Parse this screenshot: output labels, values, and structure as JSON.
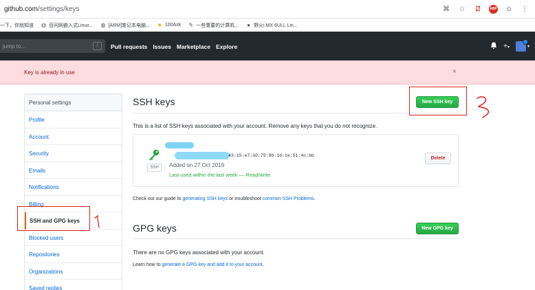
{
  "browser": {
    "url_host": "github.com",
    "url_path": "/settings/keys",
    "bookmarks": [
      {
        "icon": "page-icon",
        "label": "一下，你就知道"
      },
      {
        "icon": "globe-icon",
        "label": "百问网嵌入式Linux..."
      },
      {
        "icon": "globe-icon",
        "label": "[ARM]笔记本电脑..."
      },
      {
        "icon": "star-icon",
        "label": "100Ask"
      },
      {
        "icon": "pen-icon",
        "label": "一些重要的计算机..."
      },
      {
        "icon": "github-icon",
        "label": "野火i.MX 6ULL Lin..."
      }
    ]
  },
  "header": {
    "search_placeholder": "jump to...",
    "search_shortcut": "/",
    "nav": [
      "Pull requests",
      "Issues",
      "Marketplace",
      "Explore"
    ],
    "plus_symbol": "+",
    "caret_symbol": "▾"
  },
  "flash": {
    "message": "Key is already in use",
    "close_symbol": "×"
  },
  "sidebar": {
    "heading": "Personal settings",
    "items": [
      "Profile",
      "Account",
      "Security",
      "Emails",
      "Notifications",
      "Billing",
      "SSH and GPG keys",
      "Blocked users",
      "Repositories",
      "Organizations",
      "Saved replies"
    ],
    "selected_index": 6
  },
  "ssh": {
    "title": "SSH keys",
    "new_button": "New SSH key",
    "description": "This is a list of SSH keys associated with your account. Remove any keys that you do not recognize.",
    "key": {
      "label": "SSH",
      "fingerprint": "43:15:e7:10:75:9b:1d:1e:51:4c:bb",
      "added": "Added on 27 Oct 2019",
      "last_used": "Last used within the last week — Read/write",
      "delete_button": "Delete"
    },
    "guide_prefix": "Check out our guide to ",
    "guide_link1": "generating SSH keys",
    "guide_middle": " or troubleshoot ",
    "guide_link2": "common SSH Problems",
    "guide_suffix": "."
  },
  "gpg": {
    "title": "GPG keys",
    "new_button": "New GPG key",
    "empty": "There are no GPG keys associated with your account.",
    "learn_prefix": "Learn how to ",
    "learn_link": "generate a GPG key and add it to your account",
    "learn_suffix": "."
  },
  "colors": {
    "header_bg": "#24292e",
    "flash_bg": "#ffdce0",
    "link": "#0366d6",
    "green": "#28a745",
    "annotation": "#e0201c"
  }
}
